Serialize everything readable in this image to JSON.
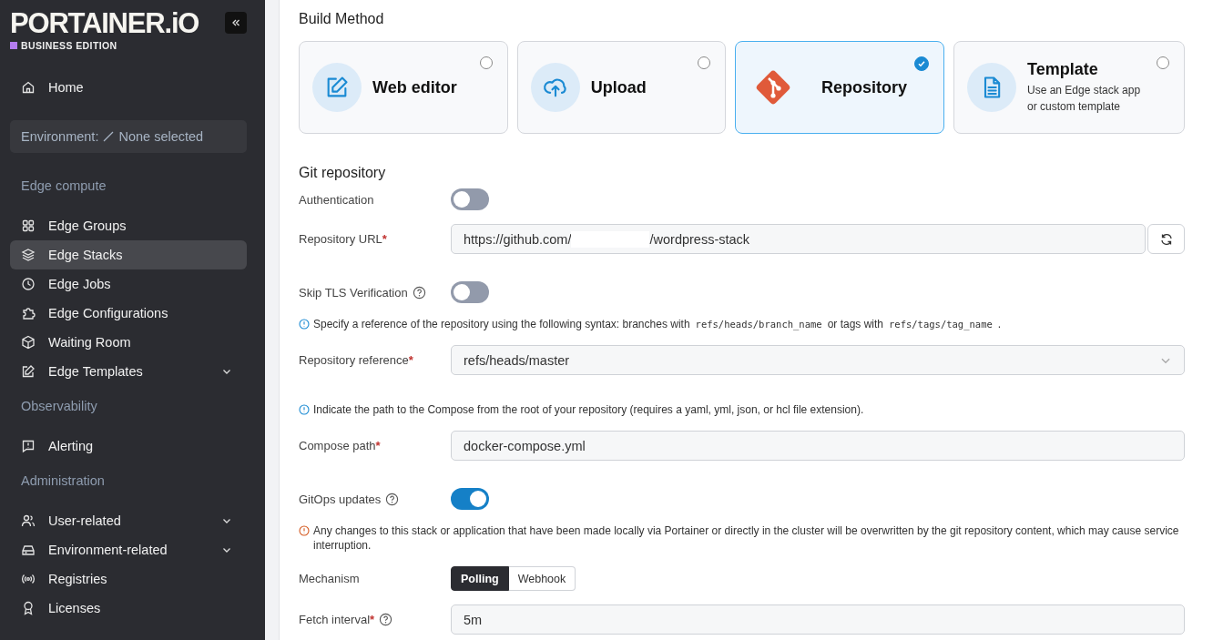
{
  "sidebar": {
    "logo": "PORTAINER.iO",
    "edition": "BUSINESS EDITION",
    "environment": {
      "label": "Environment:",
      "value": "None selected"
    },
    "sections": [
      {
        "items": [
          {
            "label": "Home",
            "selected": false,
            "has_submenu": false
          }
        ]
      },
      {
        "title": "Edge compute",
        "items": [
          {
            "label": "Edge Groups",
            "selected": false,
            "has_submenu": false
          },
          {
            "label": "Edge Stacks",
            "selected": true,
            "has_submenu": false
          },
          {
            "label": "Edge Jobs",
            "selected": false,
            "has_submenu": false
          },
          {
            "label": "Edge Configurations",
            "selected": false,
            "has_submenu": false
          },
          {
            "label": "Waiting Room",
            "selected": false,
            "has_submenu": false
          },
          {
            "label": "Edge Templates",
            "selected": false,
            "has_submenu": true
          }
        ]
      },
      {
        "title": "Observability",
        "items": [
          {
            "label": "Alerting",
            "selected": false,
            "has_submenu": false
          }
        ]
      },
      {
        "title": "Administration",
        "items": [
          {
            "label": "User-related",
            "selected": false,
            "has_submenu": true
          },
          {
            "label": "Environment-related",
            "selected": false,
            "has_submenu": true
          },
          {
            "label": "Registries",
            "selected": false,
            "has_submenu": false
          },
          {
            "label": "Licenses",
            "selected": false,
            "has_submenu": false
          }
        ]
      }
    ]
  },
  "build_method": {
    "title": "Build Method",
    "options": [
      {
        "title": "Web editor",
        "selected": false
      },
      {
        "title": "Upload",
        "selected": false
      },
      {
        "title": "Repository",
        "selected": true
      },
      {
        "title": "Template",
        "description": "Use an Edge stack app or custom template",
        "selected": false
      }
    ]
  },
  "form": [
    {
      "kind": "heading",
      "text": "Git repository"
    },
    {
      "kind": "toggle",
      "label": "Authentication",
      "on": false
    },
    {
      "kind": "url",
      "label": "Repository URL",
      "required_mark": "*",
      "value_start": "https://github.com/",
      "value_end": "/wordpress-stack"
    },
    {
      "kind": "toggle",
      "label": "Skip TLS Verification",
      "help": true,
      "on": false
    },
    {
      "kind": "info",
      "segments": [
        {
          "text": "Specify a reference of the repository using the following syntax: branches with",
          "code": false
        },
        {
          "text": "refs/heads/branch_name",
          "code": true
        },
        {
          "text": "or tags with",
          "code": false
        },
        {
          "text": "refs/tags/tag_name",
          "code": true
        },
        {
          "text": ".",
          "code": false
        }
      ]
    },
    {
      "kind": "select",
      "label": "Repository reference",
      "required_mark": "*",
      "value": "refs/heads/master"
    },
    {
      "kind": "info",
      "segments": [
        {
          "text": "Indicate the path to the Compose from the root of your repository (requires a yaml, yml, json, or hcl file extension).",
          "code": false
        }
      ]
    },
    {
      "kind": "input",
      "label": "Compose path",
      "required_mark": "*",
      "value": "docker-compose.yml"
    },
    {
      "kind": "toggle",
      "label": "GitOps updates",
      "help": true,
      "on": true
    },
    {
      "kind": "warning",
      "text": "Any changes to this stack or application that have been made locally via Portainer or directly in the cluster will be overwritten by the git repository content, which may cause service interruption."
    },
    {
      "kind": "segmented",
      "label": "Mechanism",
      "options": [
        {
          "label": "Polling",
          "selected": true
        },
        {
          "label": "Webhook",
          "selected": false
        }
      ]
    },
    {
      "kind": "input",
      "label": "Fetch interval",
      "required_mark": "*",
      "help": true,
      "value": "5m"
    }
  ]
}
